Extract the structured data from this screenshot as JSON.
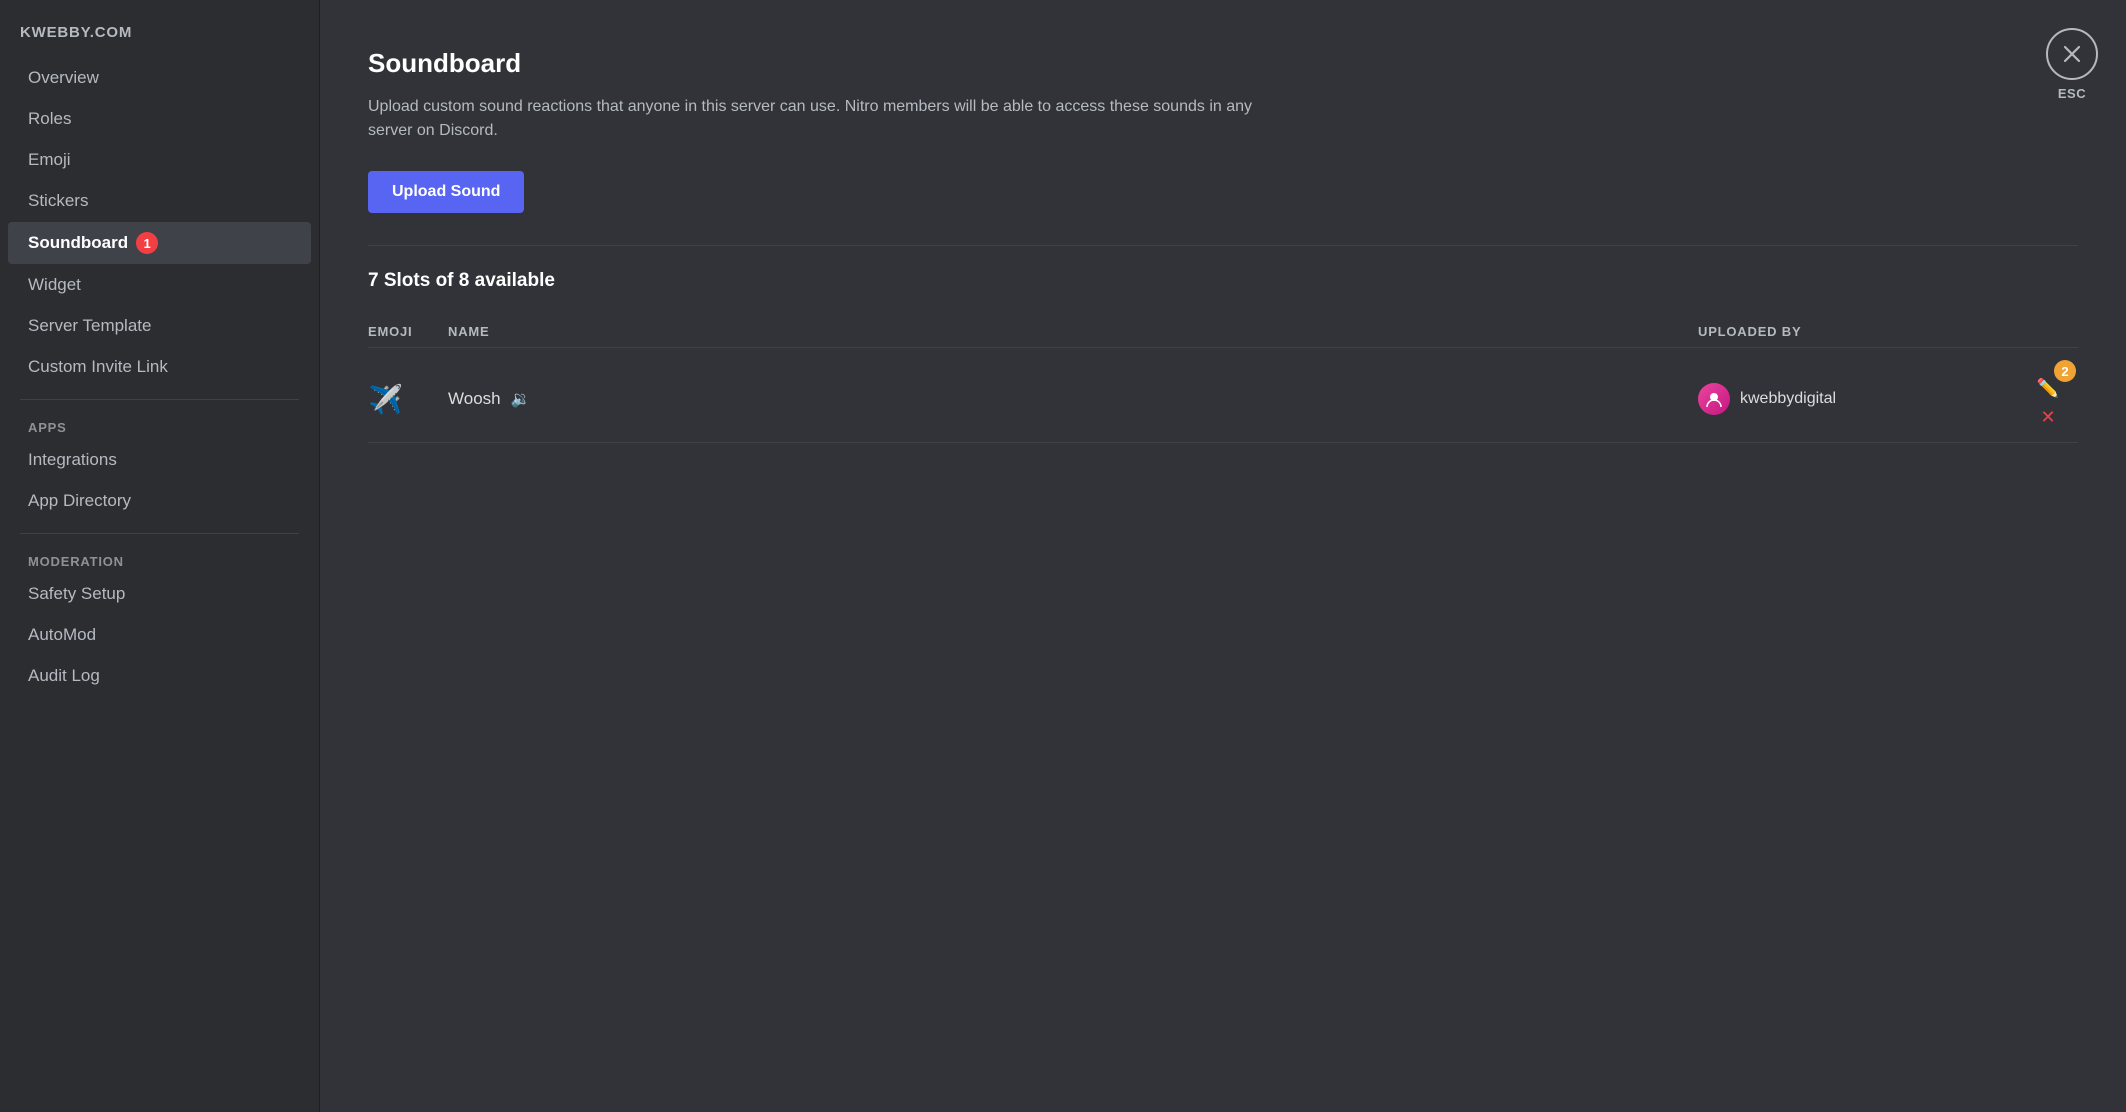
{
  "sidebar": {
    "server_name": "KWEBBY.COM",
    "items": [
      {
        "id": "overview",
        "label": "Overview",
        "active": false,
        "badge": null
      },
      {
        "id": "roles",
        "label": "Roles",
        "active": false,
        "badge": null
      },
      {
        "id": "emoji",
        "label": "Emoji",
        "active": false,
        "badge": null
      },
      {
        "id": "stickers",
        "label": "Stickers",
        "active": false,
        "badge": null
      },
      {
        "id": "soundboard",
        "label": "Soundboard",
        "active": true,
        "badge": "1"
      },
      {
        "id": "widget",
        "label": "Widget",
        "active": false,
        "badge": null
      },
      {
        "id": "server-template",
        "label": "Server Template",
        "active": false,
        "badge": null
      },
      {
        "id": "custom-invite-link",
        "label": "Custom Invite Link",
        "active": false,
        "badge": null
      }
    ],
    "sections": [
      {
        "label": "APPS",
        "items": [
          {
            "id": "integrations",
            "label": "Integrations",
            "active": false
          },
          {
            "id": "app-directory",
            "label": "App Directory",
            "active": false
          }
        ]
      },
      {
        "label": "MODERATION",
        "items": [
          {
            "id": "safety-setup",
            "label": "Safety Setup",
            "active": false
          },
          {
            "id": "automod",
            "label": "AutoMod",
            "active": false
          },
          {
            "id": "audit-log",
            "label": "Audit Log",
            "active": false
          }
        ]
      }
    ]
  },
  "main": {
    "title": "Soundboard",
    "description": "Upload custom sound reactions that anyone in this server can use. Nitro members will be able to access these sounds in any server on Discord.",
    "upload_button_label": "Upload Sound",
    "slots_text": "7 Slots of 8 available",
    "table": {
      "columns": [
        {
          "id": "emoji",
          "label": "EMOJI"
        },
        {
          "id": "name",
          "label": "NAME"
        },
        {
          "id": "uploaded_by",
          "label": "UPLOADED BY"
        },
        {
          "id": "actions",
          "label": ""
        }
      ],
      "rows": [
        {
          "emoji": "✈️",
          "name": "Woosh",
          "uploader": "kwebbydigital",
          "action_badge": "2"
        }
      ]
    },
    "close_label": "ESC"
  }
}
